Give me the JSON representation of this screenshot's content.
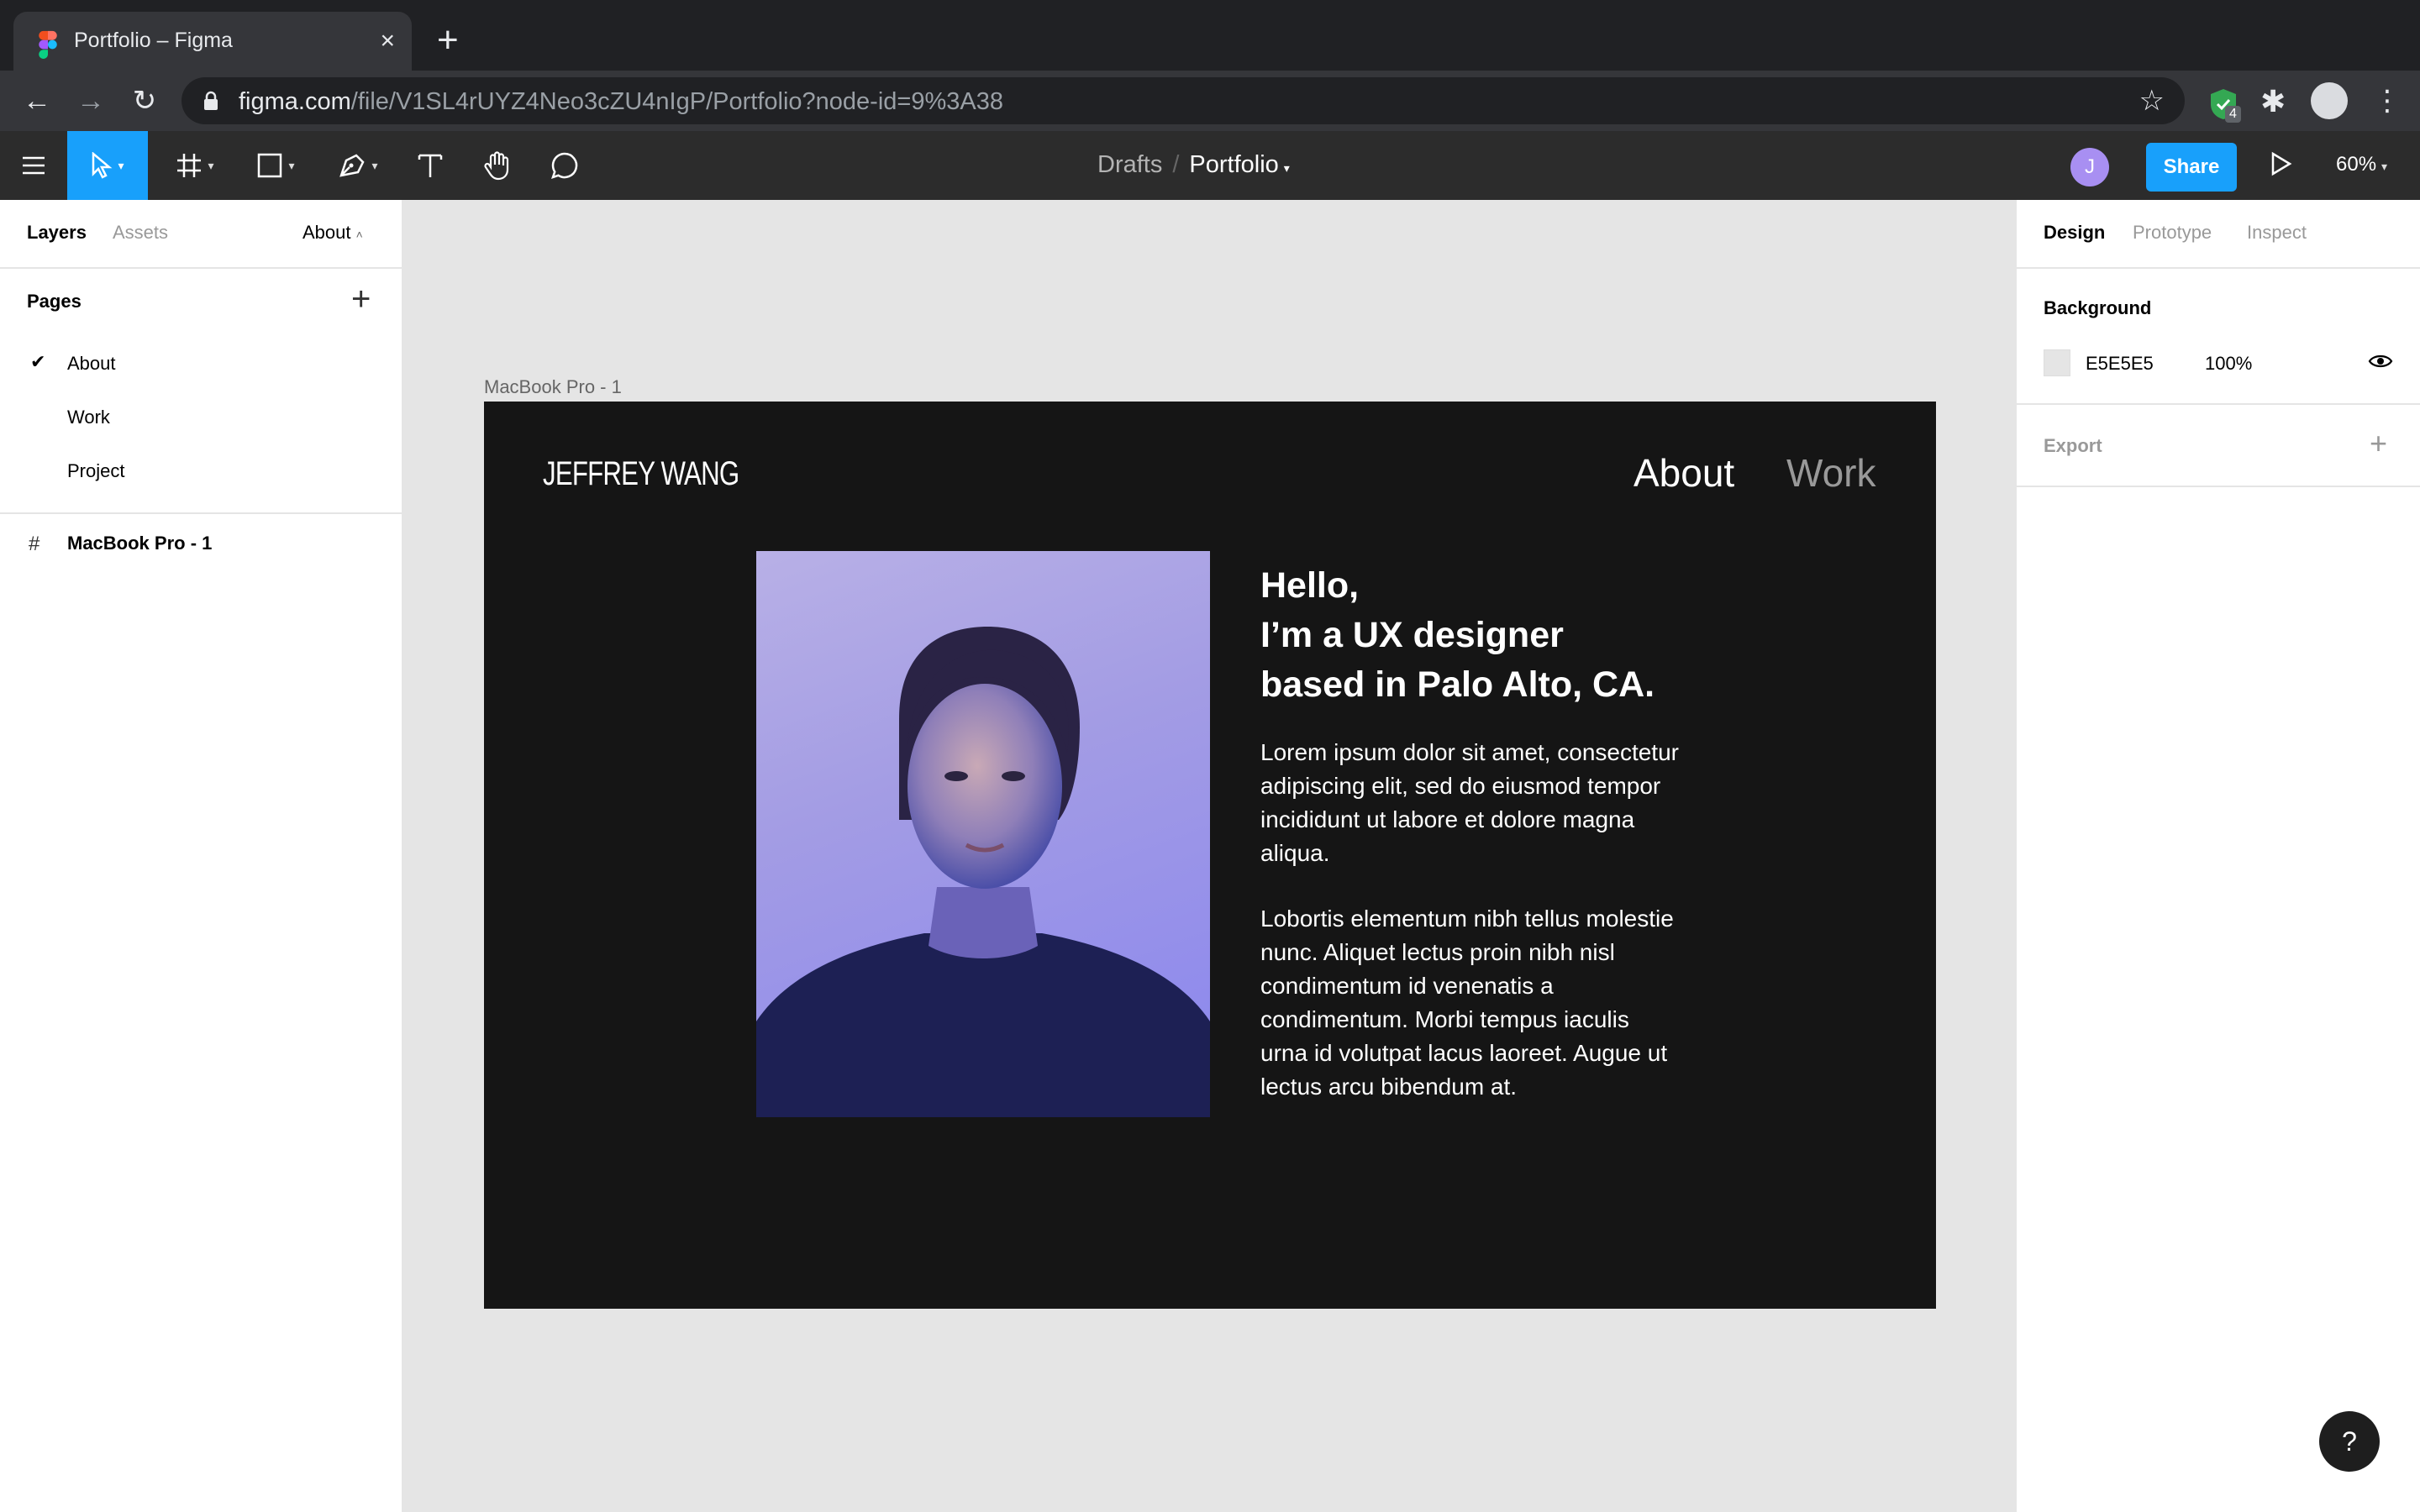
{
  "browser": {
    "tab_title": "Portfolio – Figma",
    "tab_close": "×",
    "new_tab": "+",
    "url_host": "figma.com",
    "url_path": "/file/V1SL4rUYZ4Neo3cZU4nIgP/Portfolio?node-id=9%3A38",
    "extension_badge": "4"
  },
  "toolbar": {
    "breadcrumb_parent": "Drafts",
    "breadcrumb_sep": "/",
    "file_name": "Portfolio",
    "user_initial": "J",
    "share_label": "Share",
    "zoom": "60%"
  },
  "left_panel": {
    "tabs": {
      "layers": "Layers",
      "assets": "Assets"
    },
    "current_page": "About",
    "pages_title": "Pages",
    "pages": [
      {
        "label": "About",
        "active": true
      },
      {
        "label": "Work",
        "active": false
      },
      {
        "label": "Project",
        "active": false
      }
    ],
    "layers": [
      {
        "label": "MacBook Pro - 1"
      }
    ]
  },
  "right_panel": {
    "tabs": {
      "design": "Design",
      "prototype": "Prototype",
      "inspect": "Inspect"
    },
    "background_title": "Background",
    "background_hex": "E5E5E5",
    "background_opacity": "100%",
    "export_title": "Export"
  },
  "canvas": {
    "frame_label": "MacBook Pro - 1",
    "site": {
      "logo": "JEFFREY WANG",
      "nav_about": "About",
      "nav_work": "Work",
      "headline_1": "Hello,",
      "headline_2": "I’m a UX designer",
      "headline_3": "based in Palo Alto, CA.",
      "paragraph_1": "Lorem ipsum dolor sit amet, consectetur adipiscing elit, sed do eiusmod tempor incididunt ut labore et dolore magna aliqua.",
      "paragraph_2": "Lobortis elementum nibh tellus molestie nunc. Aliquet lectus proin nibh nisl condimentum id venenatis a condimentum. Morbi tempus iaculis urna id volutpat lacus laoreet. Augue ut lectus arcu bibendum at."
    }
  },
  "help": "?",
  "colors": {
    "accent": "#18a0fb",
    "toolbar_bg": "#2c2c2c",
    "canvas_bg": "#e5e5e5",
    "frame_bg": "#151515"
  }
}
